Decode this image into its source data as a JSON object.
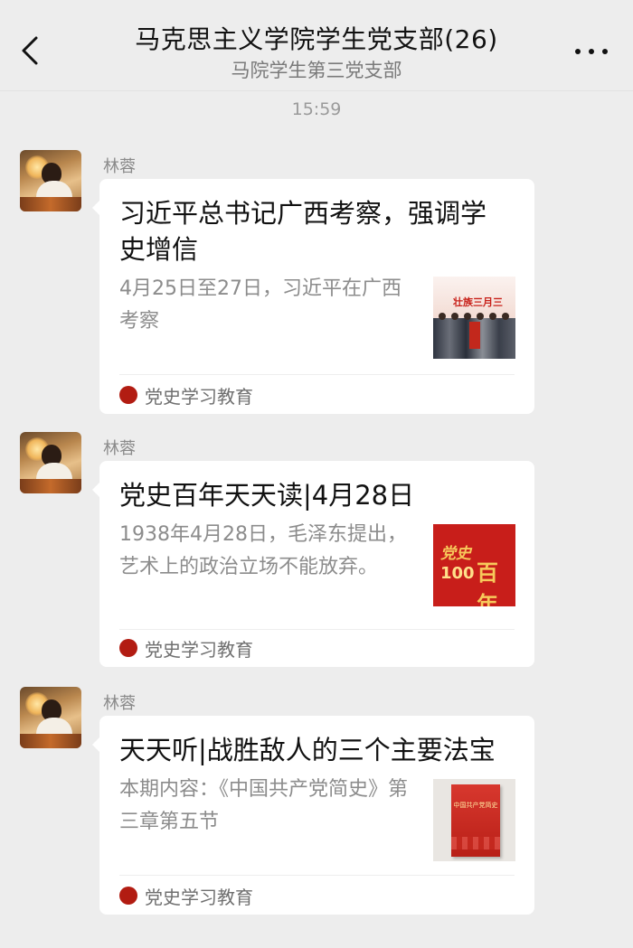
{
  "header": {
    "title": "马克思主义学院学生党支部(26)",
    "subtitle": "马院学生第三党支部"
  },
  "timestamp": "15:59",
  "messages": [
    {
      "sender": "林蓉",
      "title": "习近平总书记广西考察，强调学史增信",
      "description": "4月25日至27日，习近平在广西考察",
      "source": "党史学习教育",
      "thumb_text": "壮族三月三"
    },
    {
      "sender": "林蓉",
      "title": "党史百年天天读|4月28日",
      "description": "1938年4月28日，毛泽东提出，艺术上的政治立场不能放弃。",
      "source": "党史学习教育",
      "thumb_text_1": "党史",
      "thumb_text_2": "100",
      "thumb_text_3": "百年"
    },
    {
      "sender": "林蓉",
      "title": "天天听|战胜敌人的三个主要法宝",
      "description": "本期内容：《中国共产党简史》第三章第五节",
      "source": "党史学习教育",
      "thumb_text": "中国共产党简史"
    }
  ],
  "source_logo_text": "党史学习教育"
}
